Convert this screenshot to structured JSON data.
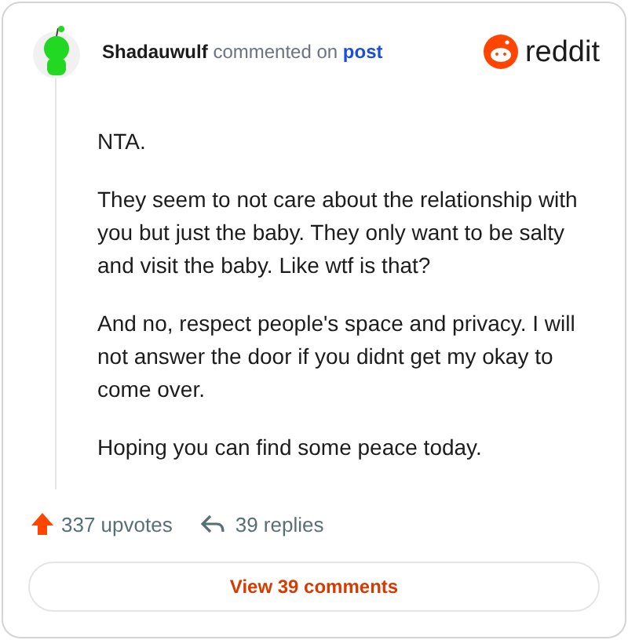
{
  "header": {
    "username": "Shadauwulf",
    "action": "commented on",
    "link": "post",
    "brand": "reddit"
  },
  "paragraphs": [
    "NTA.",
    "They seem to not care about the relationship with you but just the baby. They only want to be salty and visit the baby. Like wtf is that?",
    "And no, respect people's space and privacy. I will not answer the door if you didnt get my okay to come over.",
    "Hoping you can find some peace today."
  ],
  "footer": {
    "upvotes": "337 upvotes",
    "replies": "39 replies"
  },
  "button": "View 39 comments"
}
